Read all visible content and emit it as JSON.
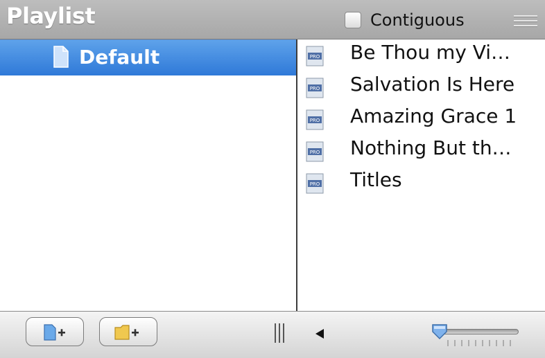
{
  "header": {
    "title": "Playlist",
    "contiguous_label": "Contiguous",
    "contiguous_checked": false
  },
  "playlists": [
    {
      "label": "Default",
      "selected": true,
      "icon": "document-icon"
    }
  ],
  "items": [
    {
      "label": "Be Thou my Vi…",
      "icon": "pro-document-icon"
    },
    {
      "label": "Salvation Is Here",
      "icon": "pro-document-icon"
    },
    {
      "label": "Amazing Grace 1",
      "icon": "pro-document-icon"
    },
    {
      "label": "Nothing But th…",
      "icon": "pro-document-icon"
    },
    {
      "label": "Titles",
      "icon": "pro-document-icon"
    }
  ],
  "footer": {
    "add_playlist_icon": "document-plus-icon",
    "add_folder_icon": "folder-plus-icon",
    "grip_icon": "resize-grip-icon",
    "back_icon": "triangle-left-icon",
    "slider_value": 0
  },
  "colors": {
    "selection": "#3b86e0",
    "header": "#b2b2b2"
  }
}
